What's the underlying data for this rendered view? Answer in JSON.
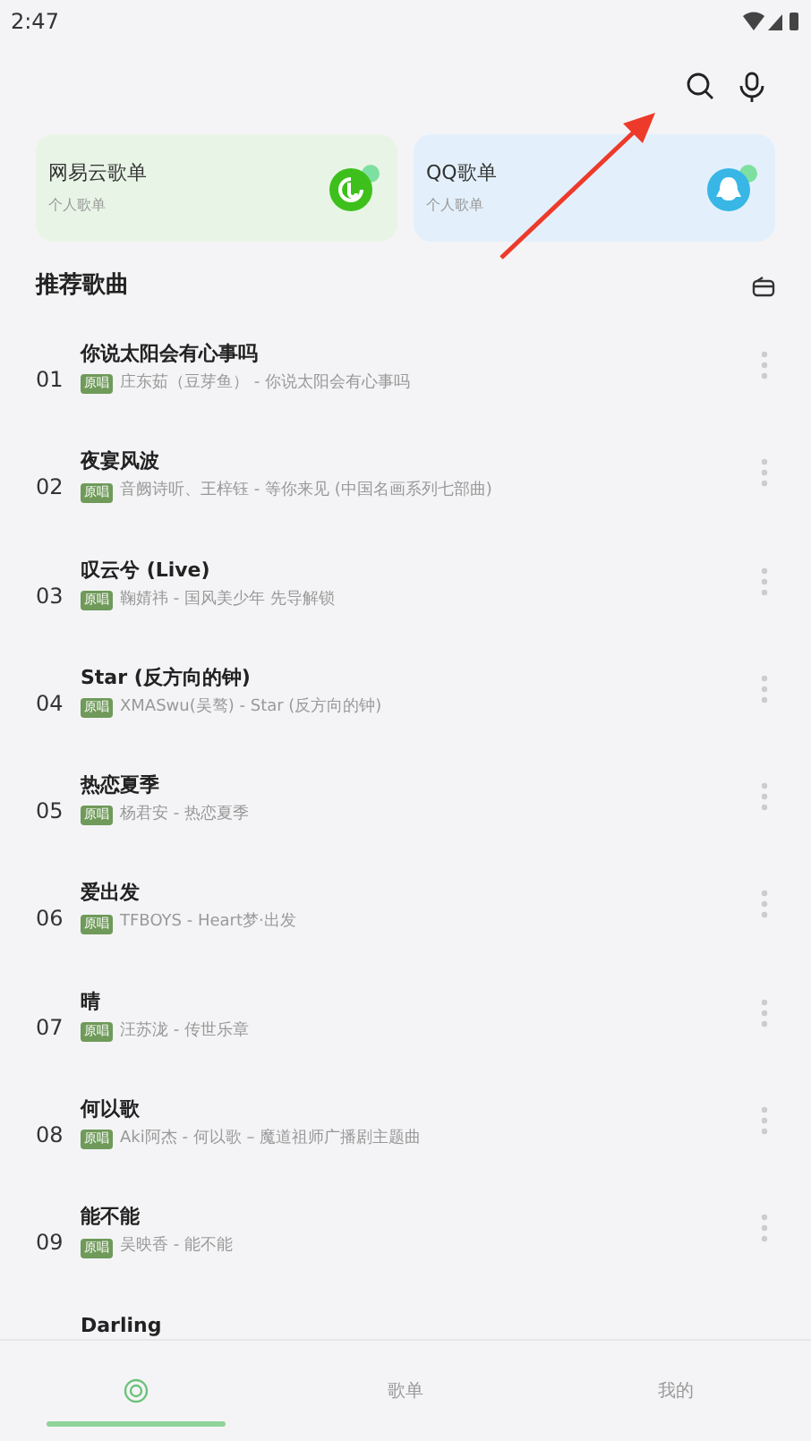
{
  "status_bar": {
    "time": "2:47"
  },
  "cards": [
    {
      "title": "网易云歌单",
      "subtitle": "个人歌单",
      "kind": "netease",
      "color": "#e8f5e6"
    },
    {
      "title": "QQ歌单",
      "subtitle": "个人歌单",
      "kind": "qq",
      "color": "#e3f0fb"
    }
  ],
  "section": {
    "title": "推荐歌曲"
  },
  "songs": [
    {
      "number": "01",
      "title": "你说太阳会有心事吗",
      "badge": "原唱",
      "artist": "庄东茹（豆芽鱼） - 你说太阳会有心事吗"
    },
    {
      "number": "02",
      "title": "夜宴风波",
      "badge": "原唱",
      "artist": "音阙诗听、王梓钰 - 等你来见 (中国名画系列七部曲)"
    },
    {
      "number": "03",
      "title": "叹云兮 (Live)",
      "badge": "原唱",
      "artist": "鞠婧祎 - 国风美少年 先导解锁"
    },
    {
      "number": "04",
      "title": "Star (反方向的钟)",
      "badge": "原唱",
      "artist": "XMASwu(吴骜) - Star (反方向的钟)"
    },
    {
      "number": "05",
      "title": "热恋夏季",
      "badge": "原唱",
      "artist": "杨君安 - 热恋夏季"
    },
    {
      "number": "06",
      "title": "爱出发",
      "badge": "原唱",
      "artist": "TFBOYS - Heart梦·出发"
    },
    {
      "number": "07",
      "title": "晴",
      "badge": "原唱",
      "artist": "汪苏泷 - 传世乐章"
    },
    {
      "number": "08",
      "title": "何以歌",
      "badge": "原唱",
      "artist": "Aki阿杰 - 何以歌 – 魔道祖师广播剧主题曲"
    },
    {
      "number": "09",
      "title": "能不能",
      "badge": "原唱",
      "artist": "吴映香 - 能不能"
    },
    {
      "title": "Darling"
    }
  ],
  "tabs": [
    {
      "kind": "icon",
      "selected": true
    },
    {
      "kind": "text",
      "label": "歌单",
      "selected": false
    },
    {
      "kind": "text",
      "label": "我的",
      "selected": false
    }
  ]
}
